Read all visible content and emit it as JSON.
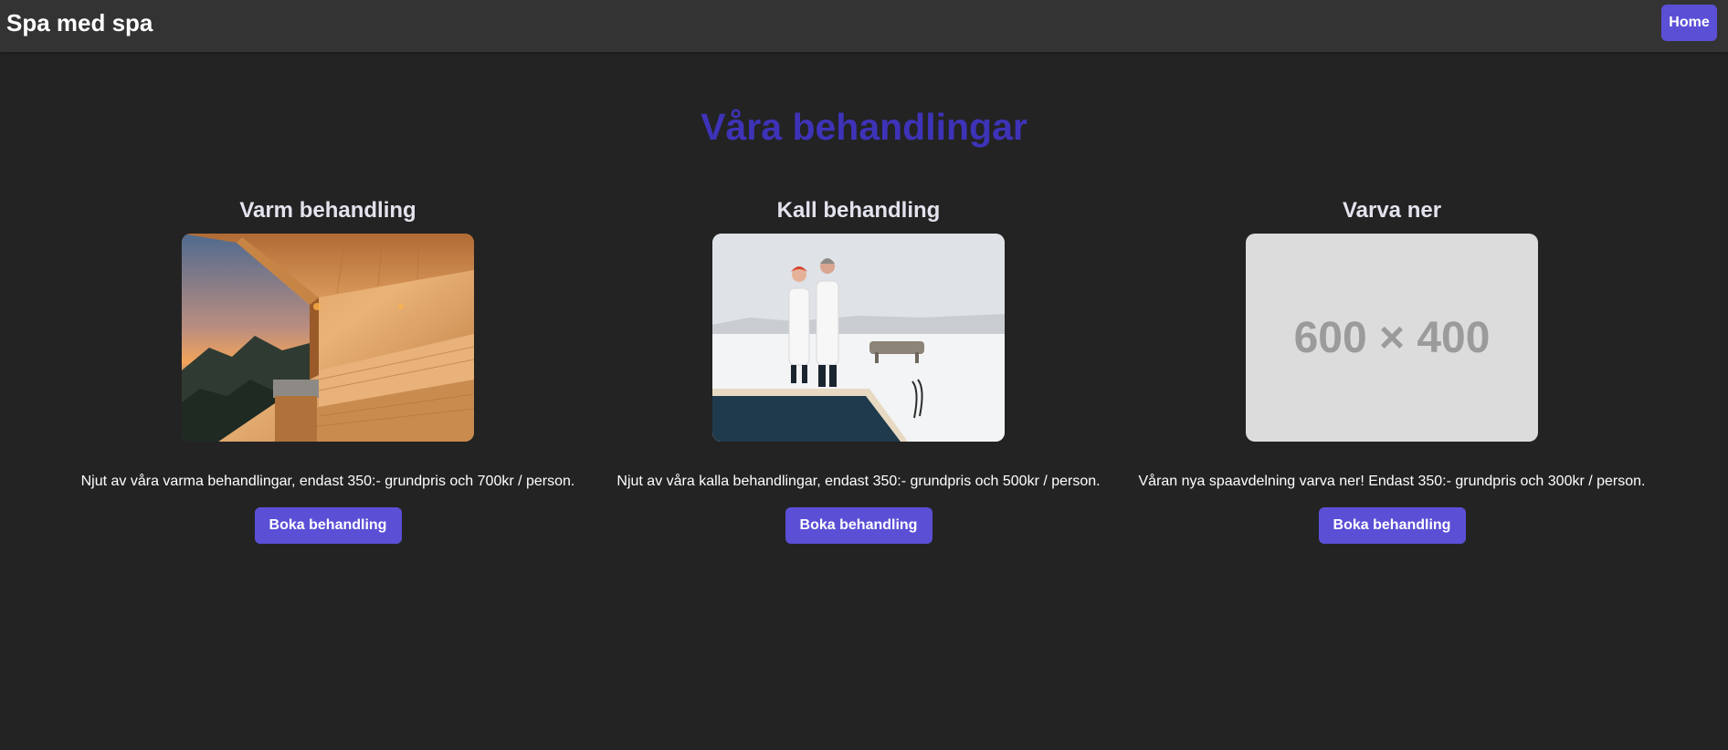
{
  "nav": {
    "brand": "Spa med spa",
    "home_label": "Home"
  },
  "main": {
    "title": "Våra behandlingar",
    "cards": [
      {
        "title": "Varm behandling",
        "description": "Njut av våra varma behandlingar, endast 350:- grundpris och 700kr / person.",
        "button": "Boka behandling"
      },
      {
        "title": "Kall behandling",
        "description": "Njut av våra kalla behandlingar, endast 350:- grundpris och 500kr / person.",
        "button": "Boka behandling"
      },
      {
        "title": "Varva ner",
        "description": "Våran nya spaavdelning varva ner! Endast 350:- grundpris och 300kr / person.",
        "button": "Boka behandling",
        "placeholder_text": "600 × 400"
      }
    ]
  },
  "colors": {
    "background": "#232323",
    "navbar": "#333333",
    "accent": "#5b4fd6",
    "title": "#3e33b8"
  }
}
